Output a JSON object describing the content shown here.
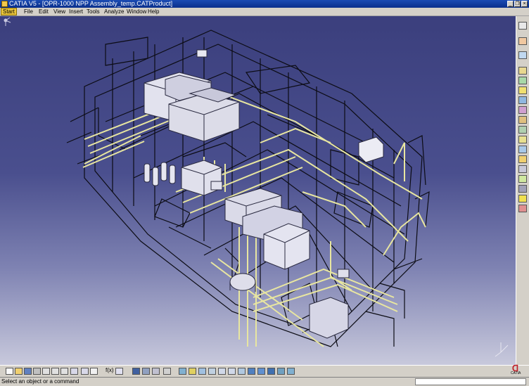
{
  "window": {
    "title": "CATIA V5 - [OPR-1000 NPP Assembly_temp.CATProduct]"
  },
  "window_buttons": {
    "minimize": "_",
    "restore": "❐",
    "close": "×"
  },
  "menu": {
    "start": "Start",
    "file": "File",
    "edit": "Edit",
    "view": "View",
    "insert": "Insert",
    "tools": "Tools",
    "analyze": "Analyze",
    "window": "Window",
    "help": "Help"
  },
  "bottom_toolbar": {
    "fog_label": "f(x)"
  },
  "status": {
    "message": "Select an object or a command",
    "command_value": "",
    "command_placeholder": ""
  },
  "logo": {
    "text": "CATIA"
  },
  "colors": {
    "viewport_top": "#3b3f7d",
    "viewport_bottom": "#c8c9dc",
    "pipe_yellow": "#e8e6a0",
    "structure_black": "#0c0c14",
    "equipment_white": "#dcdce8"
  },
  "icons": {
    "app": "catia-app-icon",
    "compass": "compass-icon",
    "axis": "xyz-axis-icon"
  }
}
